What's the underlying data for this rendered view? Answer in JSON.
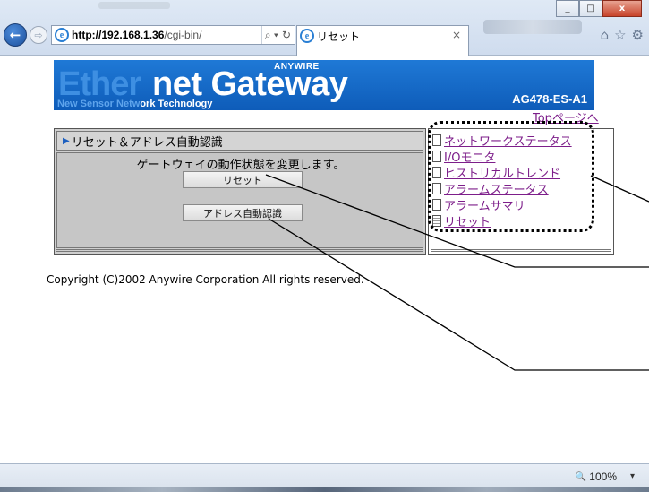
{
  "browser": {
    "url_host": "http://192.168.1.36",
    "url_rest": "/cgi-bin/",
    "search_glyph": "⌕ ▾",
    "refresh_glyph": "↻",
    "tab_title": "リセット",
    "tab_close": "×",
    "window_min": "_",
    "window_max": "□",
    "window_close": "x",
    "zoom": "100%",
    "zoom_icon": "🔍",
    "zoom_caret": "▾"
  },
  "banner": {
    "ether": "Ether",
    "net_gateway": "net Gateway",
    "brand": "ANYWIRE",
    "tagline_dim": "New Sensor Netw",
    "tagline_bright": "ork Technology",
    "model": "AG478-ES-A1"
  },
  "top_link": "Topページへ",
  "left_panel": {
    "header_icon": "▶",
    "header": "リセット＆アドレス自動認識",
    "description": "ゲートウェイの動作状態を変更します。",
    "reset_button": "リセット",
    "addr_button": "アドレス自動認識"
  },
  "menu": [
    {
      "label": "ネットワークステータス",
      "icon": "doc-icon"
    },
    {
      "label": "I/Oモニタ",
      "icon": "doc-icon"
    },
    {
      "label": "ヒストリカルトレンド",
      "icon": "doc-icon"
    },
    {
      "label": "アラームステータス",
      "icon": "doc-icon"
    },
    {
      "label": "アラームサマリ",
      "icon": "doc-icon"
    },
    {
      "label": "リセット",
      "icon": "doc-lines-icon"
    }
  ],
  "copyright": "Copyright (C)2002 Anywire Corporation All rights reserved."
}
